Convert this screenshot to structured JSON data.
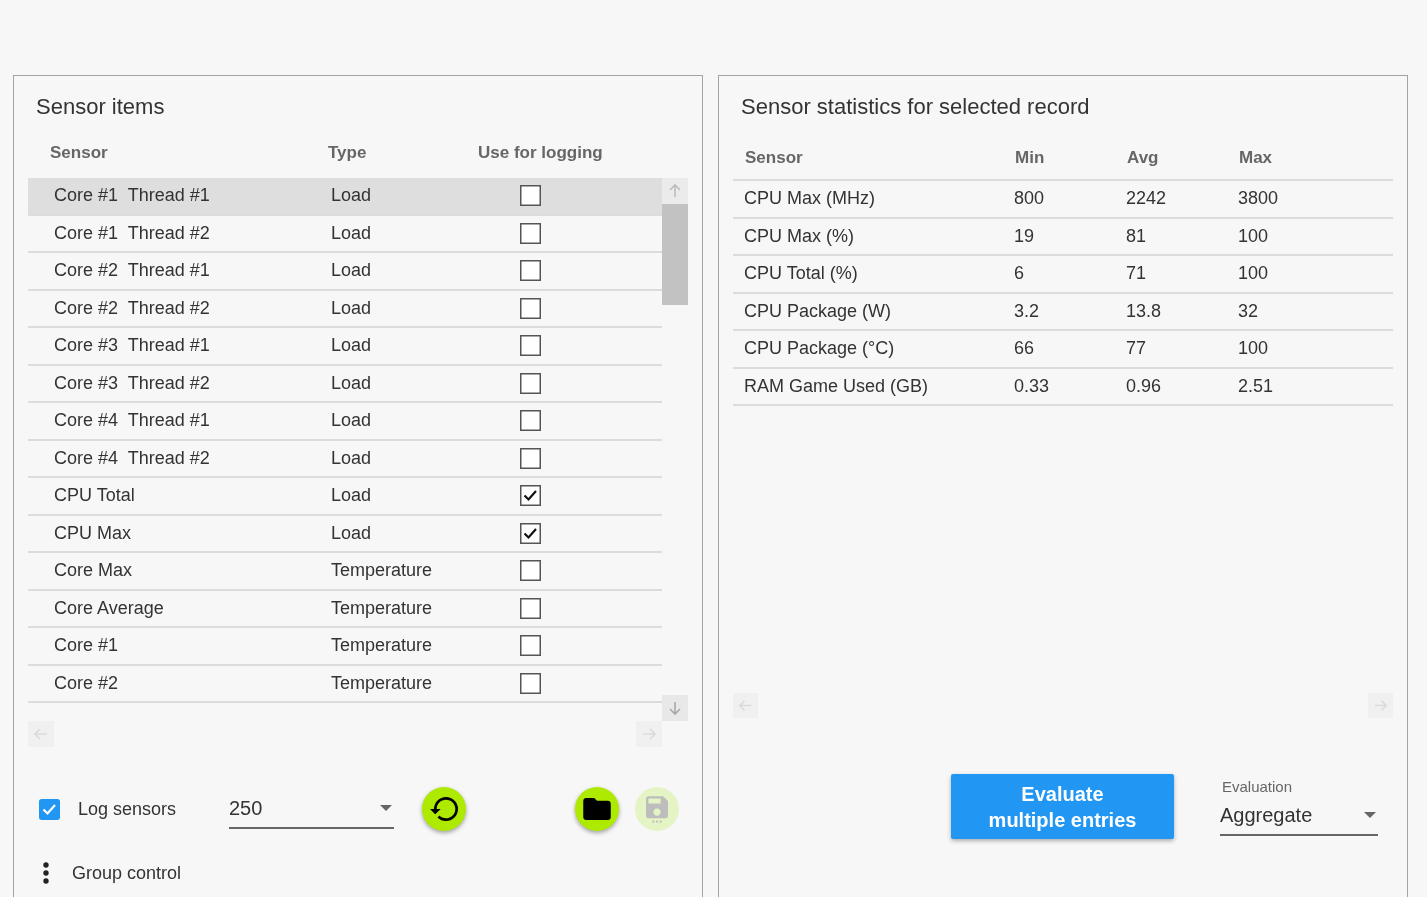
{
  "sensor_items": {
    "title": "Sensor items",
    "columns": [
      "Sensor",
      "Type",
      "Use for logging"
    ],
    "rows": [
      {
        "sensor": "Core #1  Thread #1",
        "type": "Load",
        "logging": false,
        "selected": true
      },
      {
        "sensor": "Core #1  Thread #2",
        "type": "Load",
        "logging": false,
        "selected": false
      },
      {
        "sensor": "Core #2  Thread #1",
        "type": "Load",
        "logging": false,
        "selected": false
      },
      {
        "sensor": "Core #2  Thread #2",
        "type": "Load",
        "logging": false,
        "selected": false
      },
      {
        "sensor": "Core #3  Thread #1",
        "type": "Load",
        "logging": false,
        "selected": false
      },
      {
        "sensor": "Core #3  Thread #2",
        "type": "Load",
        "logging": false,
        "selected": false
      },
      {
        "sensor": "Core #4  Thread #1",
        "type": "Load",
        "logging": false,
        "selected": false
      },
      {
        "sensor": "Core #4  Thread #2",
        "type": "Load",
        "logging": false,
        "selected": false
      },
      {
        "sensor": "CPU Total",
        "type": "Load",
        "logging": true,
        "selected": false
      },
      {
        "sensor": "CPU Max",
        "type": "Load",
        "logging": true,
        "selected": false
      },
      {
        "sensor": "Core Max",
        "type": "Temperature",
        "logging": false,
        "selected": false
      },
      {
        "sensor": "Core Average",
        "type": "Temperature",
        "logging": false,
        "selected": false
      },
      {
        "sensor": "Core #1",
        "type": "Temperature",
        "logging": false,
        "selected": false
      },
      {
        "sensor": "Core #2",
        "type": "Temperature",
        "logging": false,
        "selected": false
      }
    ]
  },
  "logging_controls": {
    "log_sensors": {
      "label": "Log sensors",
      "checked": true
    },
    "dropdown": {
      "value": "250"
    },
    "buttons": [
      {
        "kind": "restore",
        "disabled": false
      },
      {
        "kind": "folder",
        "disabled": false
      },
      {
        "kind": "save",
        "disabled": true
      }
    ],
    "group_control": {
      "label": "Group control"
    }
  },
  "sensor_statistics": {
    "title": "Sensor statistics for selected record",
    "columns": [
      "Sensor",
      "Min",
      "Avg",
      "Max"
    ],
    "rows": [
      [
        "CPU Max (MHz)",
        "800",
        "2242",
        "3800"
      ],
      [
        "CPU Max (%)",
        "19",
        "81",
        "100"
      ],
      [
        "CPU Total (%)",
        "6",
        "71",
        "100"
      ],
      [
        "CPU Package (W)",
        "3.2",
        "13.8",
        "32"
      ],
      [
        "CPU Package (°C)",
        "66",
        "77",
        "100"
      ],
      [
        "RAM Game Used (GB)",
        "0.33",
        "0.96",
        "2.51"
      ]
    ]
  },
  "evaluate_button": {
    "label": "Evaluate multiple entries"
  },
  "evaluation": {
    "label": "Evaluation",
    "value": "Aggregate"
  }
}
